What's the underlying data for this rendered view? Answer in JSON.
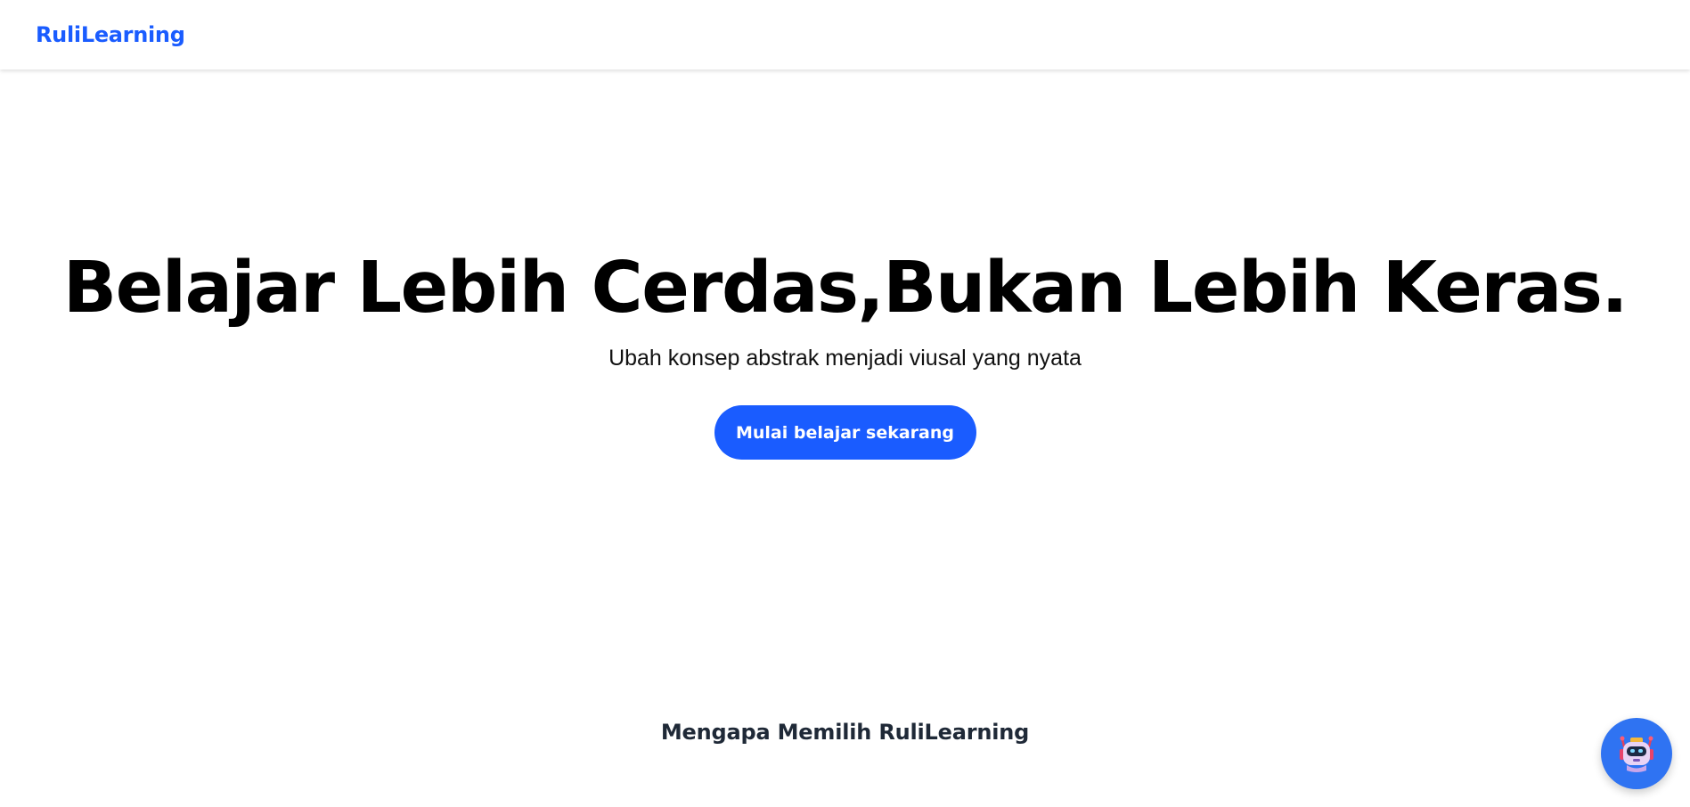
{
  "navbar": {
    "brand": "RuliLearning"
  },
  "hero": {
    "title": "Belajar Lebih Cerdas,Bukan Lebih Keras.",
    "subtitle": "Ubah konsep abstrak menjadi viusal yang nyata",
    "cta_label": "Mulai belajar sekarang"
  },
  "why": {
    "heading": "Mengapa Memilih RuliLearning"
  },
  "chatbot": {
    "icon": "robot-icon"
  },
  "colors": {
    "accent": "#1a5cff",
    "chatbot_bg": "#2f73f2",
    "heading_dark": "#1f2937"
  }
}
